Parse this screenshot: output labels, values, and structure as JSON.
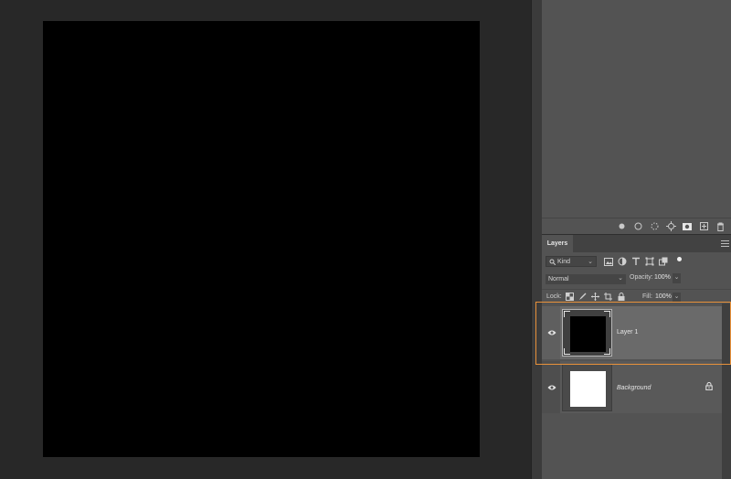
{
  "document": {
    "canvas_color": "#000000"
  },
  "upper_toolbar": {
    "icons": [
      "circle-filled-icon",
      "circle-outline-icon",
      "dashed-circle-icon",
      "target-icon",
      "mask-icon",
      "new-panel-icon",
      "trash-icon"
    ]
  },
  "layers_panel": {
    "tab_label": "Layers",
    "filter": {
      "kind_label": "Kind",
      "icons": [
        "image-filter-icon",
        "adjustment-filter-icon",
        "type-filter-icon",
        "shape-filter-icon",
        "smart-object-filter-icon"
      ]
    },
    "blend_mode": "Normal",
    "opacity_label": "Opacity:",
    "opacity_value": "100%",
    "lock_label": "Lock:",
    "fill_label": "Fill:",
    "fill_value": "100%",
    "layers": [
      {
        "name": "Layer 1",
        "thumbnail_color": "#000000",
        "selected": true,
        "locked": false
      },
      {
        "name": "Background",
        "thumbnail_color": "#ffffff",
        "selected": false,
        "locked": true
      }
    ]
  },
  "colors": {
    "panel_bg": "#535353",
    "workspace_bg": "#282828",
    "selection_highlight": "#e8913a"
  }
}
